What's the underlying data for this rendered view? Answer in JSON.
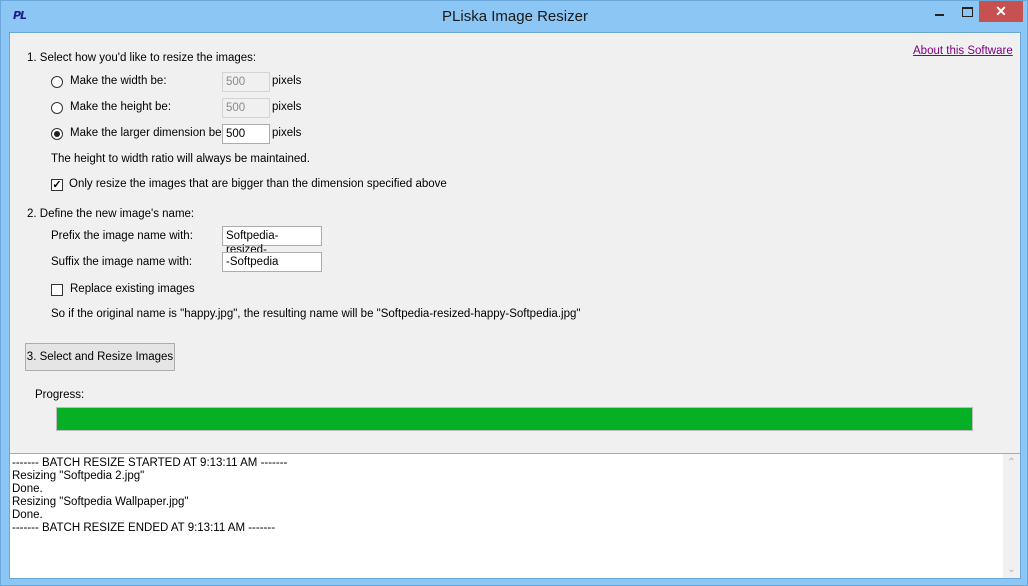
{
  "window": {
    "title": "PLiska Image Resizer",
    "app_icon_text": "PL",
    "controls": {
      "minimize": "minimize",
      "maximize": "maximize",
      "close": "✕"
    }
  },
  "about_link": "About this Software",
  "section1": {
    "heading": "1. Select how you'd like to resize the images:",
    "options": [
      {
        "label": "Make the width be:",
        "value": "500",
        "unit": "pixels",
        "selected": false,
        "enabled": false
      },
      {
        "label": "Make the height be:",
        "value": "500",
        "unit": "pixels",
        "selected": false,
        "enabled": false
      },
      {
        "label": "Make the larger dimension be:",
        "value": "500",
        "unit": "pixels",
        "selected": true,
        "enabled": true
      }
    ],
    "ratio_note": "The height to width ratio will always be maintained.",
    "only_bigger": {
      "label": "Only resize the images that are bigger than the dimension specified above",
      "checked": true
    }
  },
  "section2": {
    "heading": "2. Define the new image's name:",
    "prefix": {
      "label": "Prefix the image name with:",
      "value": "Softpedia-resized-"
    },
    "suffix": {
      "label": "Suffix the image name with:",
      "value": "-Softpedia"
    },
    "replace": {
      "label": "Replace existing images",
      "checked": false
    },
    "example": "So if the original name is \"happy.jpg\", the resulting name will be \"Softpedia-resized-happy-Softpedia.jpg\""
  },
  "action_button": "3. Select and Resize Images",
  "progress": {
    "label": "Progress:",
    "percent": 100,
    "color": "#06b025"
  },
  "log": {
    "lines": [
      "------- BATCH RESIZE STARTED AT 9:13:11 AM -------",
      "Resizing \"Softpedia 2.jpg\"",
      "Done.",
      "Resizing \"Softpedia Wallpaper.jpg\"",
      "Done.",
      "------- BATCH RESIZE ENDED AT 9:13:11 AM -------"
    ]
  },
  "scrollbar": {
    "up": "⌃",
    "down": "⌄"
  }
}
